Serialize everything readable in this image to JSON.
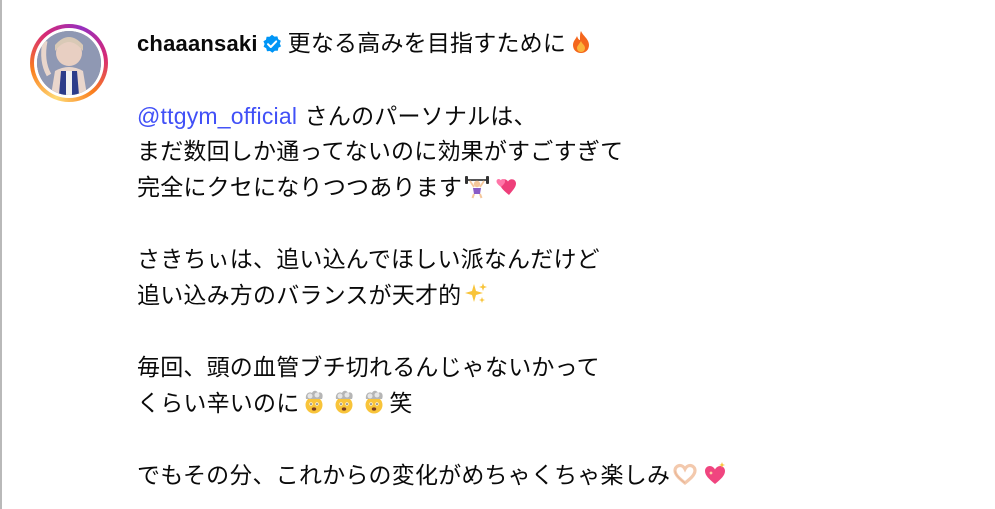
{
  "post": {
    "username": "chaaansaki",
    "headline": "更なる高みを目指すために",
    "mention": "@ttgym_official",
    "line2_rest": " さんのパーソナルは、",
    "line3": "まだ数回しか通ってないのに効果がすごすぎて",
    "line4": "完全にクセになりつつあります",
    "line5": "さきちぃは、追い込んでほしい派なんだけど",
    "line6": "追い込み方のバランスが天才的",
    "line7": "毎回、頭の血管ブチ切れるんじゃないかって",
    "line8a": "くらい辛いのに",
    "line8b": "笑",
    "line9": "でもその分、これからの変化がめちゃくちゃ楽しみ"
  },
  "icons": {
    "verified": "verified-badge-icon",
    "fire": "fire-emoji",
    "weightlifter": "woman-lifting-weights-emoji",
    "two_hearts": "two-hearts-emoji",
    "sparkles": "sparkles-emoji",
    "exploding_head": "exploding-head-emoji",
    "heart_hands": "heart-hands-emoji",
    "sparkling_heart": "sparkling-heart-emoji"
  },
  "colors": {
    "mention": "#4150f7",
    "verified": "#0095f6",
    "text": "#0a0a0a"
  }
}
